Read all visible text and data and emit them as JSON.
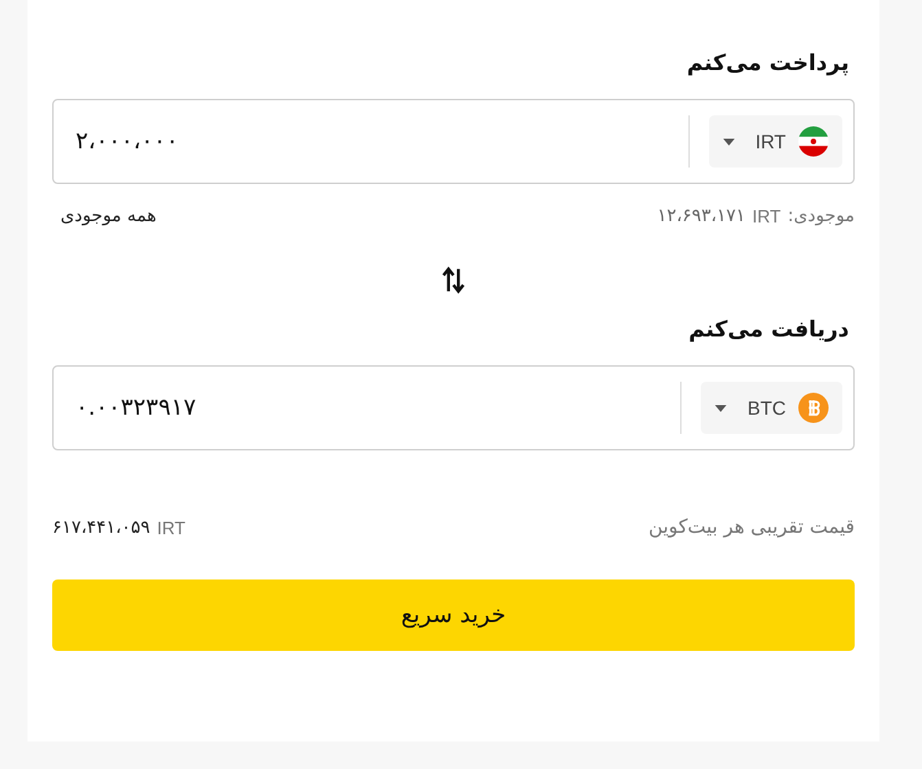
{
  "pay": {
    "label": "پرداخت می‌کنم",
    "amount": "۲،۰۰۰،۰۰۰",
    "currency": {
      "code": "IRT",
      "kind": "flag"
    }
  },
  "balance": {
    "label": "موجودی:",
    "currency": "IRT",
    "value": "۱۲،۶۹۳،۱۷۱",
    "max_link": "همه موجودی"
  },
  "receive": {
    "label": "دریافت می‌کنم",
    "amount": "۰.۰۰۳۲۳۹۱۷",
    "currency": {
      "code": "BTC",
      "kind": "coin"
    }
  },
  "rate": {
    "label": "قیمت تقریبی هر بیت‌کوین",
    "currency": "IRT",
    "value": "۶۱۷،۴۴۱،۰۵۹"
  },
  "button": "خرید سریع"
}
